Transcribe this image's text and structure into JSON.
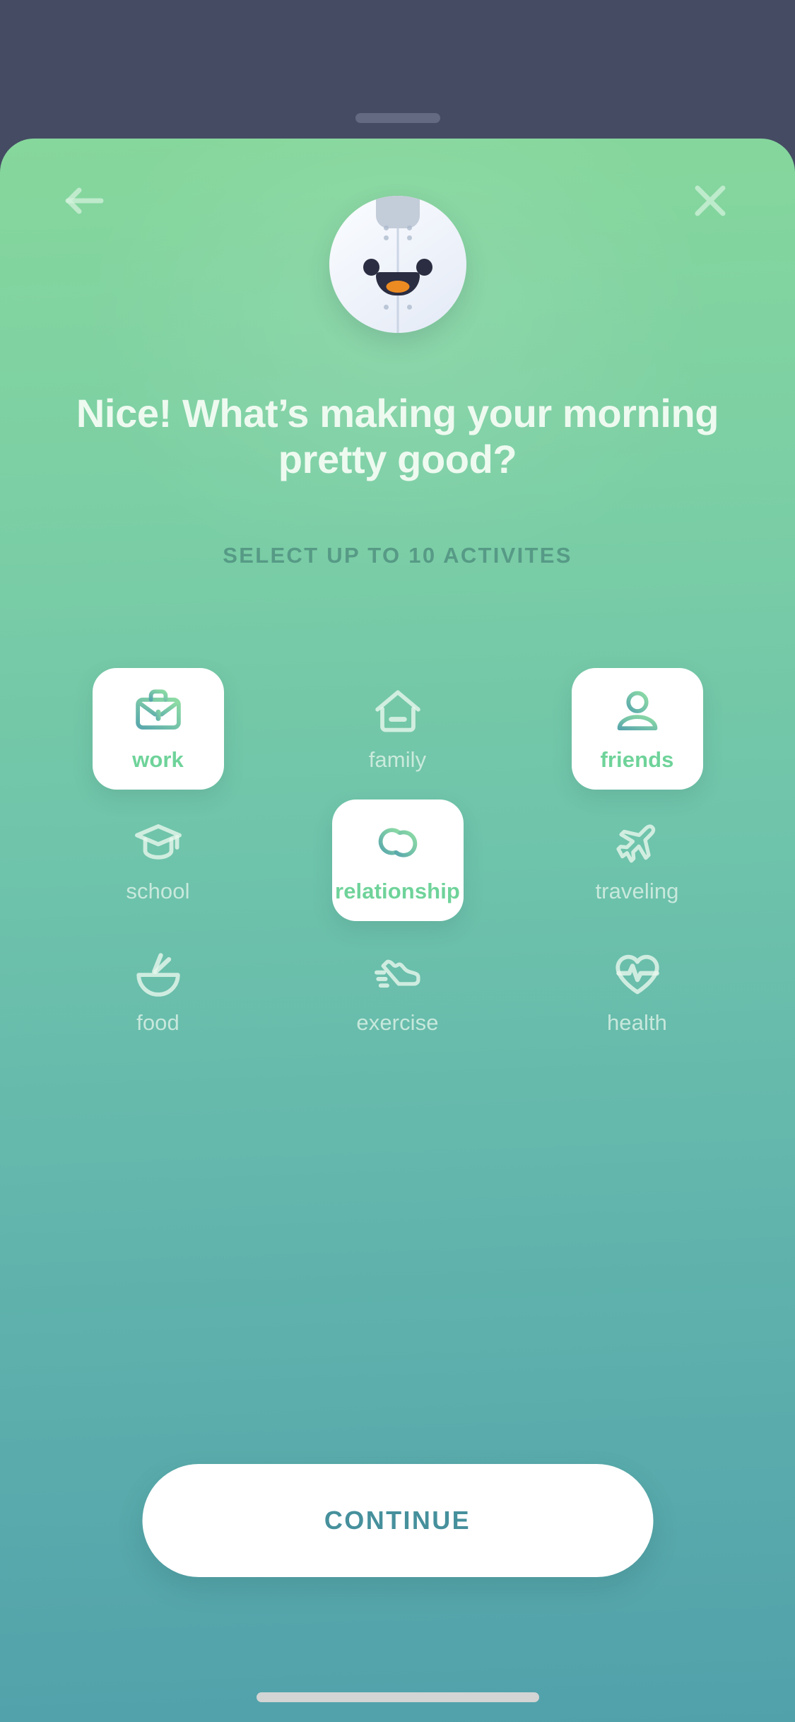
{
  "theme": {
    "backdrop_color": "#454b63",
    "sheet_gradient_top": "#86d79c",
    "sheet_gradient_bottom": "#51a1ab",
    "selected_label_color": "#6fd39a",
    "unselected_label_color": "#e8f7ee",
    "continue_text_color": "#46909c",
    "card_color": "#ffffff",
    "mascot_eye_color": "#2b2d42",
    "mascot_tongue_color": "#ec8b22",
    "mascot_cap_color": "#c3ccd9"
  },
  "topbar": {
    "back_icon": "arrow-left-icon",
    "close_icon": "close-icon"
  },
  "mascot": {
    "name": "mascot-avatar"
  },
  "header": {
    "title": "Nice! What’s making your morning pretty good?",
    "subtitle": "SELECT UP TO 10 ACTIVITES"
  },
  "activities": {
    "max_selectable": 10,
    "items": [
      {
        "id": "work",
        "label": "work",
        "icon": "briefcase-icon",
        "selected": true
      },
      {
        "id": "family",
        "label": "family",
        "icon": "house-icon",
        "selected": false
      },
      {
        "id": "friends",
        "label": "friends",
        "icon": "person-icon",
        "selected": true
      },
      {
        "id": "school",
        "label": "school",
        "icon": "graduation-cap-icon",
        "selected": false
      },
      {
        "id": "relationship",
        "label": "relationship",
        "icon": "linked-rings-icon",
        "selected": true
      },
      {
        "id": "traveling",
        "label": "traveling",
        "icon": "airplane-icon",
        "selected": false
      },
      {
        "id": "food",
        "label": "food",
        "icon": "bowl-chopsticks-icon",
        "selected": false
      },
      {
        "id": "exercise",
        "label": "exercise",
        "icon": "running-shoe-icon",
        "selected": false
      },
      {
        "id": "health",
        "label": "health",
        "icon": "heart-pulse-icon",
        "selected": false
      }
    ]
  },
  "footer": {
    "continue_label": "CONTINUE"
  }
}
